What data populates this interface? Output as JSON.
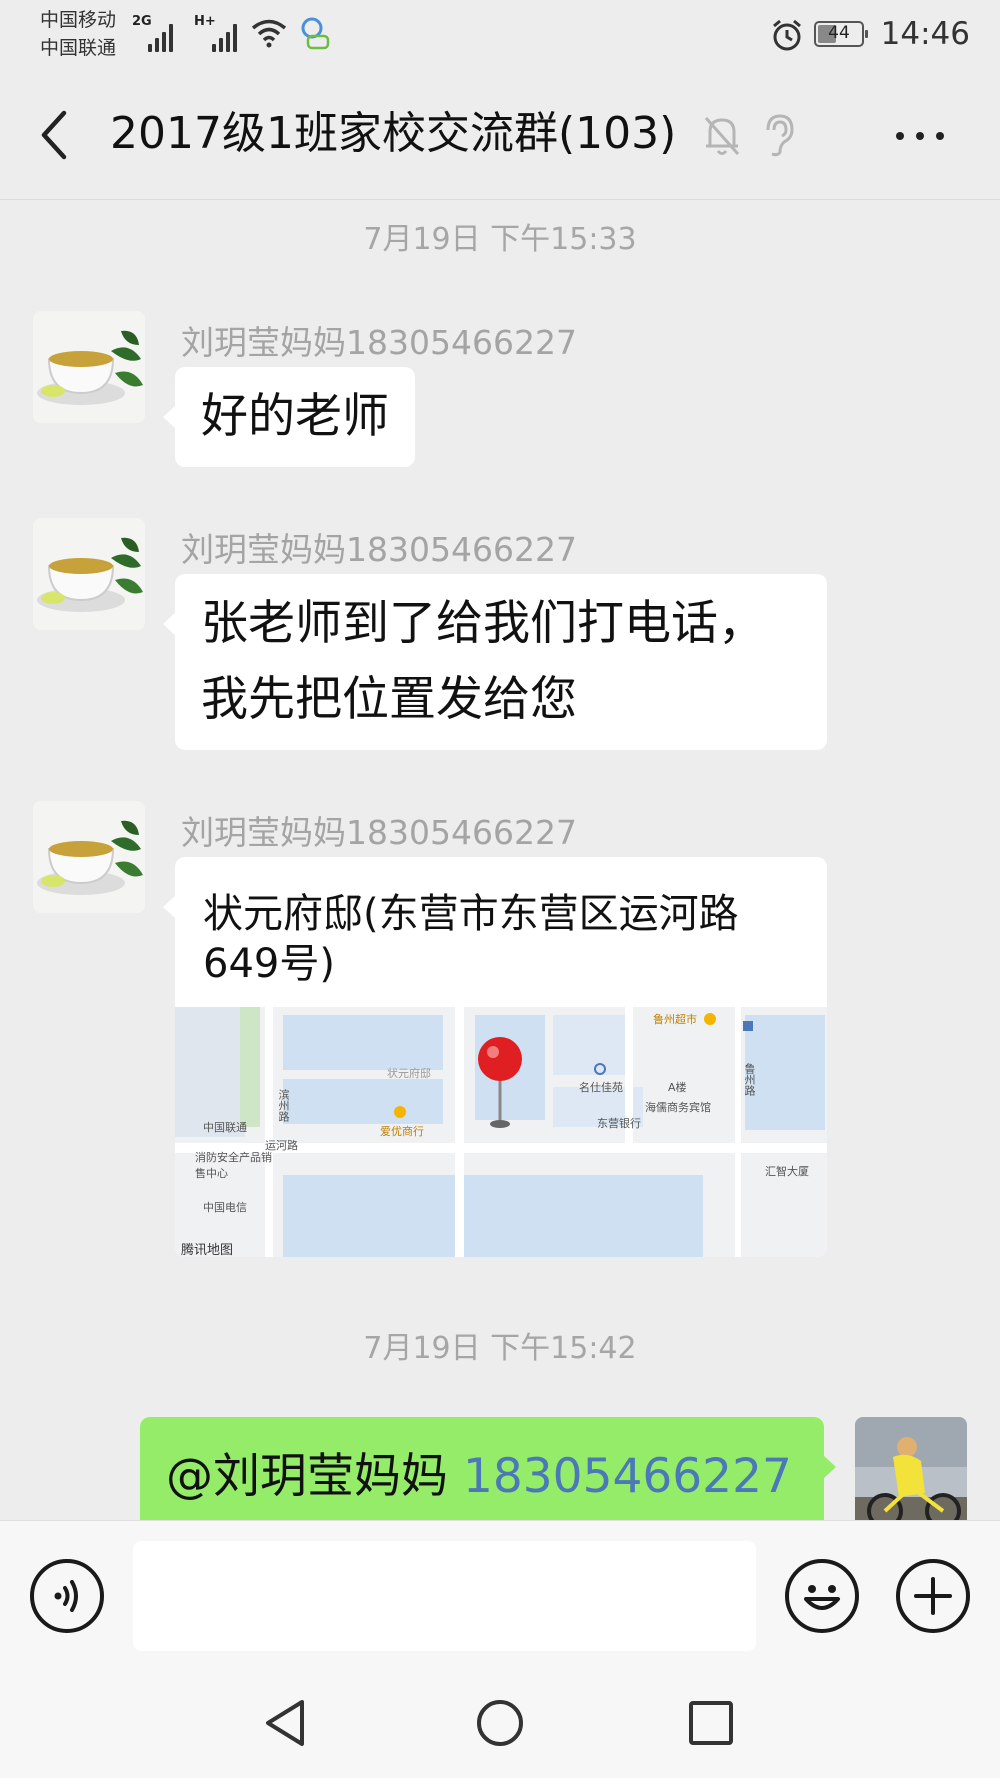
{
  "status_bar": {
    "carrier_1": "中国移动",
    "carrier_2": "中国联通",
    "net_1": "2G",
    "net_2": "H+",
    "battery": "44",
    "time": "14:46"
  },
  "header": {
    "title": "2017级1班家校交流群(103)",
    "back_icon": "chevron-left-icon",
    "mute_icon": "bell-off-icon",
    "ear_icon": "ear-icon",
    "more_icon": "more-dots-icon"
  },
  "chat": {
    "separators": [
      "7月19日 下午15:33",
      "7月19日 下午15:42"
    ],
    "messages": [
      {
        "sender": "刘玥莹妈妈18305466227",
        "text": "好的老师"
      },
      {
        "sender": "刘玥莹妈妈18305466227",
        "line1": "张老师到了给我们打电话，",
        "line2": "我先把位置发给您"
      },
      {
        "sender": "刘玥莹妈妈18305466227",
        "location_line1": "状元府邸(东营市东营区运河路",
        "location_line2": "649号)",
        "map_labels": {
          "poi_1": "鲁州超市",
          "poi_2": "状元府邸",
          "poi_3": "滨州路",
          "poi_4": "名仕佳苑",
          "poi_5": "A楼",
          "poi_6": "海儒商务宾馆",
          "poi_7": "中国联通",
          "poi_8": "爱优商行",
          "poi_9": "东营银行",
          "poi_10": "运河路",
          "poi_11": "消防安全产品销售中心",
          "poi_12": "中国电信",
          "poi_13": "汇智大厦",
          "poi_14": "鲁州路",
          "brand": "腾讯地图"
        }
      }
    ],
    "outgoing": {
      "mention": "@刘玥莹妈妈 ",
      "number": "18305466227"
    }
  },
  "input_bar": {
    "value": "",
    "voice_icon": "voice-icon",
    "emoji_icon": "emoji-icon",
    "plus_icon": "plus-icon"
  },
  "nav_bar": {
    "back_icon": "nav-back-icon",
    "home_icon": "nav-home-icon",
    "recents_icon": "nav-recents-icon"
  },
  "colors": {
    "background": "#ededed",
    "sent_bubble": "#95ec69",
    "received_bubble": "#ffffff",
    "mention_number": "#4a78b8"
  }
}
